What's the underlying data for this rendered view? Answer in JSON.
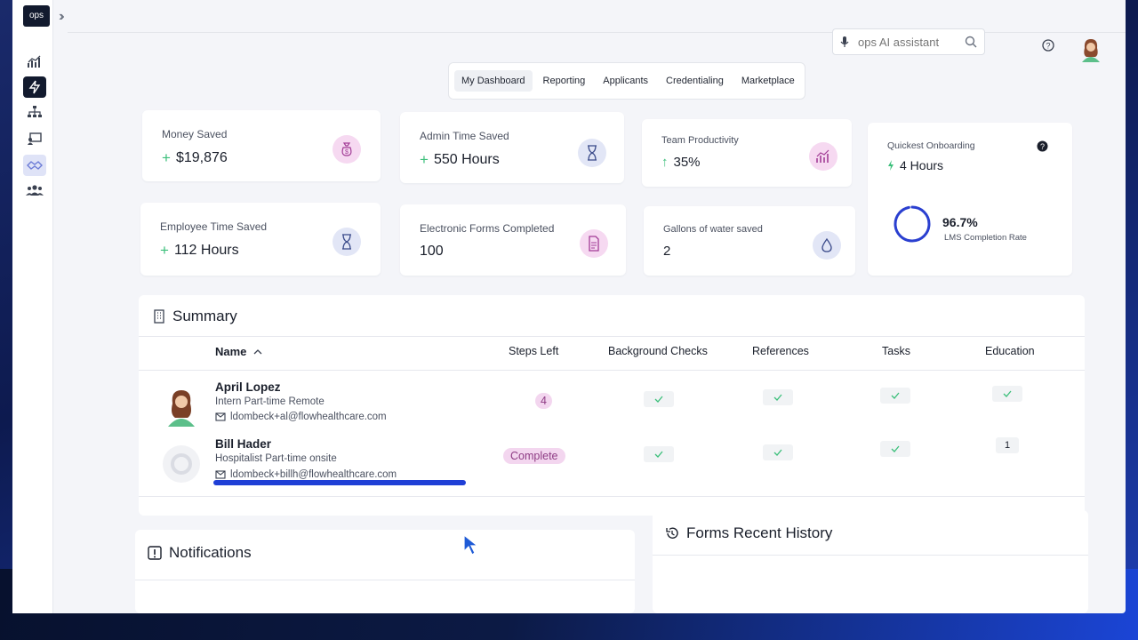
{
  "app": {
    "logo_text": "ops"
  },
  "sidebar": {
    "items": [
      {
        "name": "analytics"
      },
      {
        "name": "lightning"
      },
      {
        "name": "org-chart"
      },
      {
        "name": "presentation"
      },
      {
        "name": "handshake"
      },
      {
        "name": "team"
      }
    ]
  },
  "search": {
    "placeholder": "ops AI assistant"
  },
  "tabs": [
    {
      "label": "My Dashboard",
      "active": true
    },
    {
      "label": "Reporting"
    },
    {
      "label": "Applicants"
    },
    {
      "label": "Credentialing"
    },
    {
      "label": "Marketplace"
    }
  ],
  "cards": {
    "money_saved": {
      "label": "Money Saved",
      "value": "$19,876",
      "prefix": "+",
      "icon": "money-bag-icon"
    },
    "admin_time": {
      "label": "Admin Time Saved",
      "value": "550 Hours",
      "prefix": "+",
      "icon": "hourglass-icon"
    },
    "team_productivity": {
      "label": "Team Productivity",
      "value": "35%",
      "prefix": "↑",
      "icon": "chart-icon"
    },
    "quickest_onboarding": {
      "label": "Quickest Onboarding",
      "value": "4 Hours",
      "icon": "lightning-icon"
    },
    "lms": {
      "percent_text": "96.7%",
      "percent": 96.7,
      "label": "LMS Completion Rate"
    },
    "employee_time": {
      "label": "Employee Time Saved",
      "value": "112 Hours",
      "prefix": "+",
      "icon": "hourglass-icon"
    },
    "forms_completed": {
      "label": "Electronic Forms Completed",
      "value": "100",
      "icon": "document-icon"
    },
    "water_saved": {
      "label": "Gallons of water saved",
      "value": "2",
      "icon": "water-drop-icon"
    }
  },
  "summary": {
    "title": "Summary",
    "columns": [
      "Name",
      "Steps Left",
      "Background Checks",
      "References",
      "Tasks",
      "Education"
    ],
    "rows": [
      {
        "name": "April Lopez",
        "role": "Intern Part-time Remote",
        "email": "ldombeck+al@flowhealthcare.com",
        "steps_left": "4",
        "background": true,
        "references": true,
        "tasks": true,
        "education": true
      },
      {
        "name": "Bill Hader",
        "role": "Hospitalist Part-time onsite",
        "email": "ldombeck+billh@flowhealthcare.com",
        "steps_left": "Complete",
        "background": true,
        "references": true,
        "tasks": true,
        "education": "1"
      }
    ]
  },
  "notifications": {
    "title": "Notifications"
  },
  "forms_history": {
    "title": "Forms Recent History"
  },
  "colors": {
    "accent": "#1f3fd6",
    "pink": "#f6d9f1",
    "green": "#3bbf7a",
    "dark": "#121a2e"
  }
}
